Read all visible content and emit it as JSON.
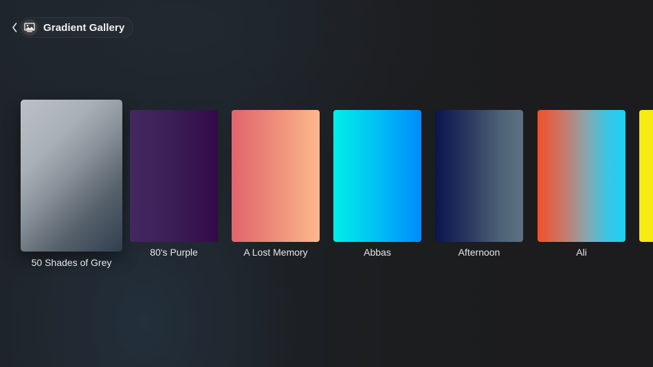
{
  "header": {
    "back_icon": "chevron-left-icon",
    "app_icon": "photo-gallery-icon",
    "title": "Gradient Gallery"
  },
  "gallery": {
    "focused_index": 0,
    "items": [
      {
        "label": "50 Shades of Grey",
        "colors": [
          "#bcc1c6",
          "#8a939b",
          "#2f3e4f"
        ]
      },
      {
        "label": "80's Purple",
        "colors": [
          "#43285f",
          "#330a48"
        ]
      },
      {
        "label": "A Lost Memory",
        "colors": [
          "#e2646d",
          "#fbb98c"
        ]
      },
      {
        "label": "Abbas",
        "colors": [
          "#00f0e6",
          "#008cfc"
        ]
      },
      {
        "label": "Afternoon",
        "colors": [
          "#0a154c",
          "#5c7282"
        ]
      },
      {
        "label": "Ali",
        "colors": [
          "#f2502a",
          "#1ad2f2"
        ]
      },
      {
        "label": "",
        "colors": [
          "#f7ec12"
        ]
      }
    ]
  }
}
